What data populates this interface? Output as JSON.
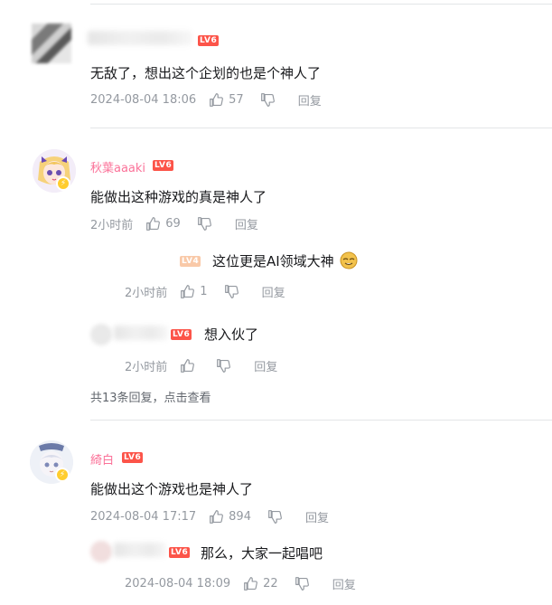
{
  "comments": [
    {
      "user": {
        "name": "",
        "level": "LV6"
      },
      "content": "无敌了，想出这个企划的也是个神人了",
      "time": "2024-08-04 18:06",
      "likes": "57",
      "reply_label": "回复"
    },
    {
      "user": {
        "name": "秋葉aaaki",
        "level": "LV6"
      },
      "content": "能做出这种游戏的真是神人了",
      "time": "2小时前",
      "likes": "69",
      "reply_label": "回复",
      "replies": [
        {
          "user": {
            "name": "",
            "level": "LV4"
          },
          "content": "这位更是AI领域大神",
          "emoji": "doge-emoji",
          "time": "2小时前",
          "likes": "1",
          "reply_label": "回复"
        },
        {
          "user": {
            "name": "",
            "level": "LV6"
          },
          "content": "想入伙了",
          "time": "2小时前",
          "likes": "",
          "reply_label": "回复"
        }
      ],
      "view_more": {
        "count_text": "共13条回复，",
        "link": "点击查看"
      }
    },
    {
      "user": {
        "name": "綺白",
        "level": "LV6"
      },
      "content": "能做出这个游戏也是神人了",
      "time": "2024-08-04 17:17",
      "likes": "894",
      "reply_label": "回复",
      "replies": [
        {
          "user": {
            "name": "",
            "level": "LV6"
          },
          "content": "那么，大家一起唱吧",
          "time": "2024-08-04 18:09",
          "likes": "22",
          "reply_label": "回复"
        }
      ]
    }
  ],
  "colors": {
    "accent": "#fb7299",
    "level_badge": "#fc5449",
    "meta": "#9499a0",
    "divider": "#e3e5e7"
  },
  "icons": {
    "like": "thumb-up-icon",
    "dislike": "thumb-down-icon",
    "lightning": "lightning-badge-icon"
  }
}
